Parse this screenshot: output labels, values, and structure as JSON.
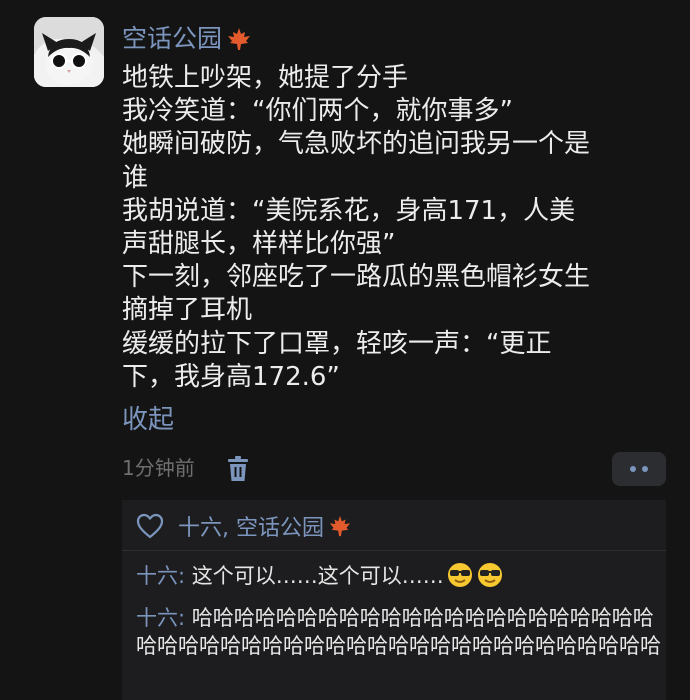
{
  "post": {
    "username": "空话公园",
    "username_badge": "maple-leaf-icon",
    "lines": [
      "地铁上吵架，她提了分手",
      "我冷笑道：“你们两个，就你事多”",
      "她瞬间破防，气急败坏的追问我另一个是",
      "谁",
      "我胡说道：“美院系花，身高171，人美",
      "声甜腿长，样样比你强”",
      "下一刻，邻座吃了一路瓜的黑色帽衫女生",
      "摘掉了耳机",
      "缓缓的拉下了口罩，轻咳一声：“更正",
      "下，我身高172.6”"
    ],
    "collapse_label": "收起",
    "timestamp": "1分钟前"
  },
  "likes": {
    "names": "十六, 空话公园"
  },
  "comments": [
    {
      "author": "十六:",
      "text": " 这个可以……这个可以……",
      "emoji": "sunglasses-emoji"
    },
    {
      "author": "十六:",
      "text": " 哈哈哈哈哈哈哈哈哈哈哈哈哈哈哈哈哈哈哈哈哈哈哈哈哈哈哈哈哈哈哈哈哈哈哈哈哈哈哈哈哈哈哈哈哈哈哈"
    }
  ],
  "colors": {
    "background": "#141414",
    "accent": "#7b95bd",
    "comment_panel": "#1d1d1f"
  }
}
